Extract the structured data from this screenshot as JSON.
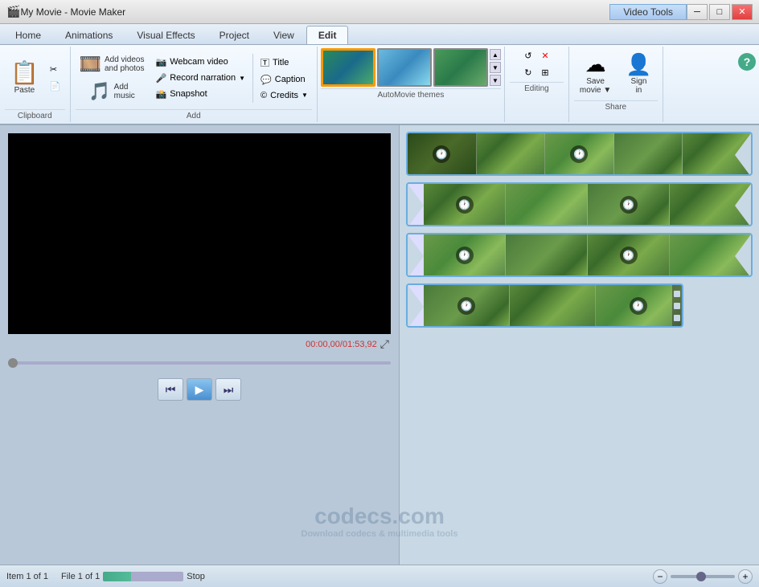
{
  "titleBar": {
    "title": "My Movie - Movie Maker",
    "videoToolsBadge": "Video Tools"
  },
  "ribbonTabs": {
    "tabs": [
      "Home",
      "Animations",
      "Visual Effects",
      "Project",
      "View",
      "Edit"
    ],
    "activeTab": "Edit"
  },
  "ribbon": {
    "groups": {
      "clipboard": {
        "label": "Clipboard",
        "paste": "Paste",
        "cut": "Cut",
        "copy": "Copy"
      },
      "add": {
        "label": "Add",
        "addVideos": "Add videos\nand photos",
        "addMusic": "Add\nmusic",
        "webcam": "Webcam video",
        "narration": "Record narration",
        "snapshot": "Snapshot",
        "title": "Title",
        "caption": "Caption",
        "credits": "Credits"
      },
      "automovie": {
        "label": "AutoMovie themes"
      },
      "editing": {
        "label": "Editing"
      },
      "share": {
        "label": "Share",
        "saveMovie": "Save\nmovie",
        "signIn": "Sign\nin"
      }
    }
  },
  "preview": {
    "timeDisplay": "00:00,00/01:53,92"
  },
  "controls": {
    "rewind": "⏮",
    "play": "▶",
    "forward": "⏭"
  },
  "statusBar": {
    "item1": "Item 1 of 1",
    "item2": "File 1 of 1",
    "stop": "Stop"
  },
  "watermark": {
    "text": "codecs.com",
    "subtext": "Download codecs & multimedia tools"
  }
}
